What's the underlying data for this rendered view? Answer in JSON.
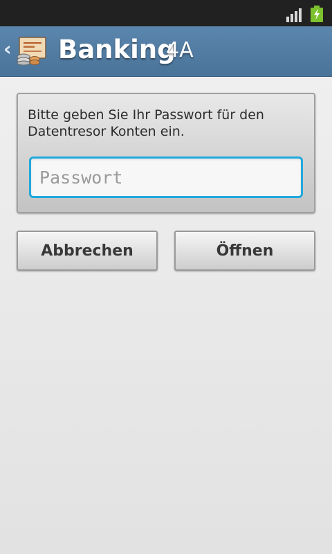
{
  "status_bar": {
    "signal_icon": "signal-bars-icon",
    "battery_icon": "battery-charging-icon",
    "battery_color": "#7cc12e"
  },
  "header": {
    "back_icon": "chevron-left-icon",
    "logo_icon": "banking-safe-coins-icon",
    "title": "Banking",
    "subtitle": "4A",
    "background_color": "#4f7aa1"
  },
  "dialog": {
    "prompt": "Bitte geben Sie Ihr Passwort für den Datentresor Konten ein.",
    "password_placeholder": "Passwort",
    "password_value": "",
    "focus_color": "#20a9dd"
  },
  "buttons": {
    "cancel_label": "Abbrechen",
    "open_label": "Öffnen"
  }
}
